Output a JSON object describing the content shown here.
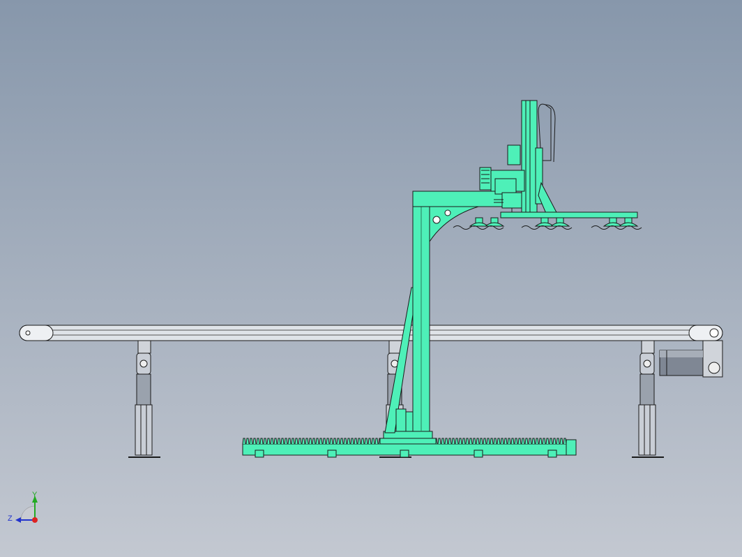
{
  "viewport": {
    "background_top": "#8797ab",
    "background_bottom": "#c3c8d1"
  },
  "colors": {
    "gantry_fill": "#4ef0b8",
    "outline": "#1a1a1a",
    "conveyor_fill": "#dfe3e8",
    "leg_fill": "#c9ced6",
    "motor_fill": "#7f8794"
  },
  "triad": {
    "y_label": "Y",
    "z_label": "Z",
    "y_color": "#22aa22",
    "z_color": "#2233cc",
    "origin_color": "#dd2222"
  }
}
